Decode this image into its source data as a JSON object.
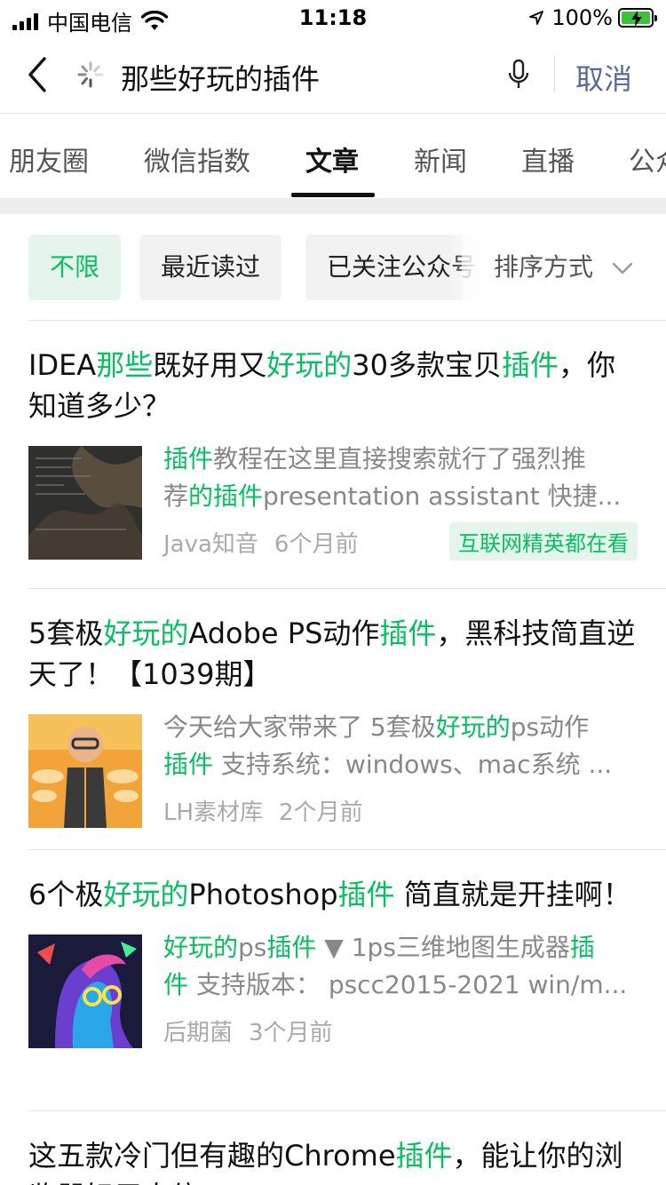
{
  "status": {
    "carrier": "中国电信",
    "time": "11:18",
    "battery": "100%"
  },
  "search": {
    "query": "那些好玩的插件",
    "cancel": "取消"
  },
  "tabs": [
    {
      "label": "朋友圈"
    },
    {
      "label": "微信指数"
    },
    {
      "label": "文章"
    },
    {
      "label": "新闻"
    },
    {
      "label": "直播"
    },
    {
      "label": "公众号"
    }
  ],
  "filters": [
    {
      "label": "不限"
    },
    {
      "label": "最近读过"
    },
    {
      "label": "已关注公众号"
    }
  ],
  "sort_label": "排序方式",
  "articles": [
    {
      "title": [
        {
          "t": "IDEA",
          "hl": false
        },
        {
          "t": "那些",
          "hl": true
        },
        {
          "t": "既好用又",
          "hl": false
        },
        {
          "t": "好玩的",
          "hl": true
        },
        {
          "t": "30多款宝贝",
          "hl": false
        },
        {
          "t": "插件",
          "hl": true
        },
        {
          "t": "，你知道多少？",
          "hl": false
        }
      ],
      "snippet_lines": [
        [
          {
            "t": "插件",
            "hl": true
          },
          {
            "t": "教程在这里直接搜索就行了强烈推",
            "hl": false
          }
        ],
        [
          {
            "t": "荐",
            "hl": false
          },
          {
            "t": "的插件",
            "hl": true
          },
          {
            "t": "presentation assistant 快捷...",
            "hl": false
          }
        ]
      ],
      "source": "Java知音",
      "time": "6个月前",
      "badge": "互联网精英都在看",
      "thumb": "dark-code-screenshot"
    },
    {
      "title": [
        {
          "t": "5套极",
          "hl": false
        },
        {
          "t": "好玩的",
          "hl": true
        },
        {
          "t": "Adobe PS动作",
          "hl": false
        },
        {
          "t": "插件",
          "hl": true
        },
        {
          "t": "，黑科技简直逆天了！【1039期】",
          "hl": false
        }
      ],
      "snippet_lines": [
        [
          {
            "t": "今天给大家带来了 5套极",
            "hl": false
          },
          {
            "t": "好玩的",
            "hl": true
          },
          {
            "t": "ps动作",
            "hl": false
          }
        ],
        [
          {
            "t": "插件",
            "hl": true
          },
          {
            "t": " 支持系统：windows、mac系统 ...",
            "hl": false
          }
        ]
      ],
      "source": "LH素材库",
      "time": "2个月前",
      "badge": "",
      "thumb": "3d-character-orange"
    },
    {
      "title": [
        {
          "t": "6个极",
          "hl": false
        },
        {
          "t": "好玩的",
          "hl": true
        },
        {
          "t": "Photoshop",
          "hl": false
        },
        {
          "t": "插件",
          "hl": true
        },
        {
          "t": " 简直就是开挂啊！",
          "hl": false
        }
      ],
      "snippet_lines": [
        [
          {
            "t": "好玩的",
            "hl": true
          },
          {
            "t": "ps",
            "hl": false
          },
          {
            "t": "插件",
            "hl": true
          },
          {
            "t": " ▼ 1ps三维地图生成器",
            "hl": false
          },
          {
            "t": "插",
            "hl": true
          }
        ],
        [
          {
            "t": "件",
            "hl": true
          },
          {
            "t": " 支持版本：  pscc2015-2021 win/m...",
            "hl": false
          }
        ]
      ],
      "source": "后期菌",
      "time": "3个月前",
      "badge": "",
      "thumb": "colorful-portrait"
    },
    {
      "title": [
        {
          "t": "这五款冷门但有趣的Chrome",
          "hl": false
        },
        {
          "t": "插件",
          "hl": true
        },
        {
          "t": "，能让你的浏览器好用十倍",
          "hl": false
        }
      ],
      "snippet_lines": [],
      "source": "",
      "time": "",
      "badge": "",
      "thumb": ""
    }
  ]
}
